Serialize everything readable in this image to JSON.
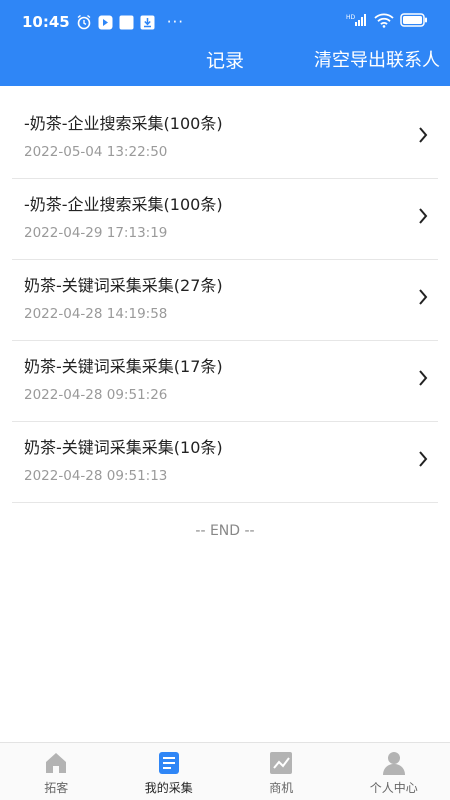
{
  "status": {
    "time": "10:45",
    "more": "···"
  },
  "header": {
    "title": "记录",
    "action": "清空导出联系人"
  },
  "records": [
    {
      "title": "-奶茶-企业搜索采集(100条)",
      "time": "2022-05-04 13:22:50"
    },
    {
      "title": "-奶茶-企业搜索采集(100条)",
      "time": "2022-04-29 17:13:19"
    },
    {
      "title": "奶茶-关键词采集采集(27条)",
      "time": "2022-04-28 14:19:58"
    },
    {
      "title": "奶茶-关键词采集采集(17条)",
      "time": "2022-04-28 09:51:26"
    },
    {
      "title": "奶茶-关键词采集采集(10条)",
      "time": "2022-04-28 09:51:13"
    }
  ],
  "end_text": "-- END --",
  "tabs": [
    {
      "label": "拓客",
      "icon": "home-icon"
    },
    {
      "label": "我的采集",
      "icon": "document-icon",
      "active": true
    },
    {
      "label": "商机",
      "icon": "chart-icon"
    },
    {
      "label": "个人中心",
      "icon": "person-icon"
    }
  ],
  "colors": {
    "primary": "#2f86f6",
    "inactive_icon": "#b3b3b3"
  }
}
